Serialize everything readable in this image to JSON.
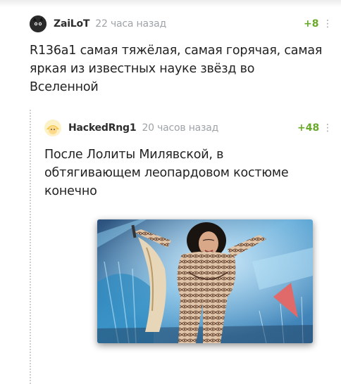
{
  "comments": [
    {
      "username": "ZaiLoT",
      "time": "22 часа назад",
      "rating": "+8",
      "text_lines": [
        "R136a1 самая тяжёлая, самая горячая, самая",
        "яркая из известных науке звёзд во",
        "Вселенной"
      ],
      "avatar_icon": "cat-avatar-icon"
    },
    {
      "username": "HackedRng1",
      "time": "20 часов назад",
      "rating": "+48",
      "text_lines": [
        "После Лолиты Милявской, в",
        "обтягивающем леопардовом костюме",
        "конечно"
      ],
      "avatar_icon": "cartoon-avatar-icon",
      "image_icon": "performer-on-stage-photo"
    }
  ],
  "menu_icon": "vertical-dots-icon",
  "colors": {
    "rating": "#68a928",
    "time": "#9ea3a8",
    "username": "#2e2e2e",
    "text": "#222222"
  }
}
